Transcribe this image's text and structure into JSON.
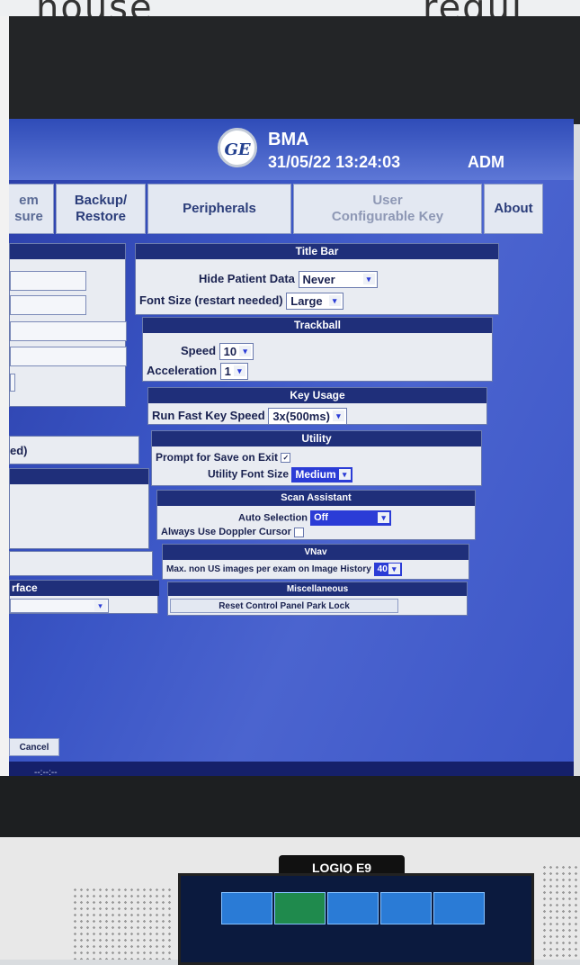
{
  "header": {
    "logo": "GE",
    "name": "BMA",
    "datetime": "31/05/22 13:24:03",
    "user": "ADM"
  },
  "tabs": [
    {
      "label": "em\nsure"
    },
    {
      "label": "Backup/\nRestore"
    },
    {
      "label": "Peripherals"
    },
    {
      "label": "User\nConfigurable Key"
    },
    {
      "label": "About"
    }
  ],
  "sections": {
    "title_bar": {
      "heading": "Title Bar",
      "hide_patient_label": "Hide Patient Data",
      "hide_patient_value": "Never",
      "font_size_label": "Font Size (restart needed)",
      "font_size_value": "Large"
    },
    "trackball": {
      "heading": "Trackball",
      "speed_label": "Speed",
      "speed_value": "10",
      "accel_label": "Acceleration",
      "accel_value": "1"
    },
    "key_usage": {
      "heading": "Key Usage",
      "fast_key_label": "Run Fast Key Speed",
      "fast_key_value": "3x(500ms)"
    },
    "utility": {
      "heading": "Utility",
      "prompt_label": "Prompt for Save on Exit",
      "font_label": "Utility Font Size",
      "font_value": "Medium"
    },
    "scan_assistant": {
      "heading": "Scan Assistant",
      "auto_label": "Auto Selection",
      "auto_value": "Off",
      "doppler_label": "Always Use Doppler Cursor"
    },
    "vnav": {
      "heading": "VNav",
      "max_label": "Max. non US images per exam on Image History",
      "max_value": "40"
    },
    "misc": {
      "heading": "Miscellaneous",
      "reset_label": "Reset Control Panel Park Lock"
    }
  },
  "left_panel": {
    "item1": "ed)",
    "item2": "rface"
  },
  "footer": {
    "cancel": "Cancel",
    "status": "--:--:--"
  },
  "device": {
    "model": "LOGIQ E9"
  },
  "colors": {
    "screen_bg": "#3a55c5",
    "section_header": "#1f2f7a",
    "select_bg": "#2b3cd6"
  }
}
